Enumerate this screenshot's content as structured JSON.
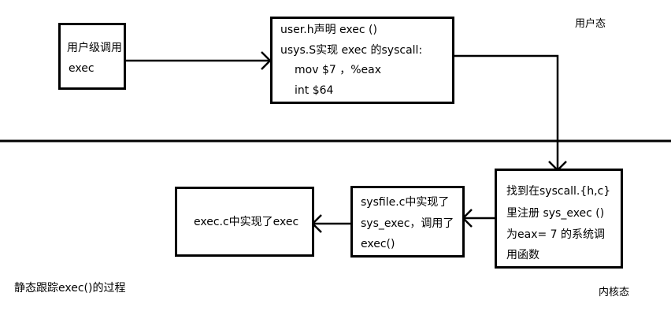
{
  "labels": {
    "user_mode": "用户态",
    "kernel_mode": "内核态",
    "caption": "静态跟踪exec()的过程"
  },
  "boxes": {
    "user_exec": {
      "lines": [
        "用户级调用",
        "exec"
      ]
    },
    "usys": {
      "lines": [
        "user.h声明 exec ()",
        "usys.S实现 exec 的syscall:",
        "mov $7 ，%eax",
        "int $64"
      ]
    },
    "syscall": {
      "lines": [
        "找到在syscall.{h,c}",
        "里注册 sys_exec ()",
        "为eax= 7 的系统调",
        "用函数"
      ]
    },
    "sysfile": {
      "lines": [
        "sysfile.c中实现了",
        "sys_exec，调用了",
        "exec()"
      ]
    },
    "execc": {
      "lines": [
        "exec.c中实现了exec"
      ]
    }
  }
}
